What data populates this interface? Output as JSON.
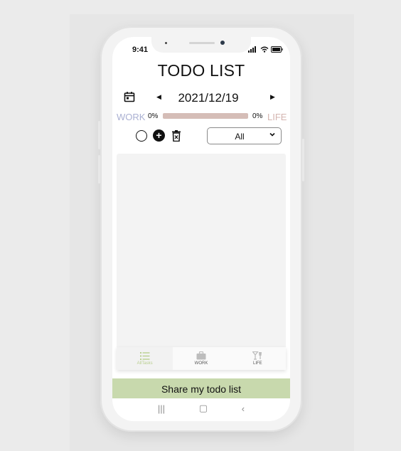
{
  "status_bar": {
    "time": "9:41"
  },
  "app": {
    "title": "TODO LIST"
  },
  "date_nav": {
    "date": "2021/12/19"
  },
  "progress": {
    "work_label": "WORK",
    "life_label": "LIFE",
    "work_percent_text": "0%",
    "life_percent_text": "0%",
    "work_fraction": 0,
    "work_color": "#aab0d2",
    "life_color": "#d4b5b0"
  },
  "filter": {
    "selected": "All"
  },
  "bottom_nav": {
    "items": [
      {
        "label": "AllTasks",
        "icon": "list-icon",
        "active": true
      },
      {
        "label": "WORK",
        "icon": "briefcase-icon",
        "active": false
      },
      {
        "label": "LIFE",
        "icon": "glass-icon",
        "active": false
      }
    ],
    "active_color": "#b9cf8f",
    "inactive_color": "#555555"
  },
  "share": {
    "label": "Share my todo list",
    "color": "#c8d9ad"
  }
}
